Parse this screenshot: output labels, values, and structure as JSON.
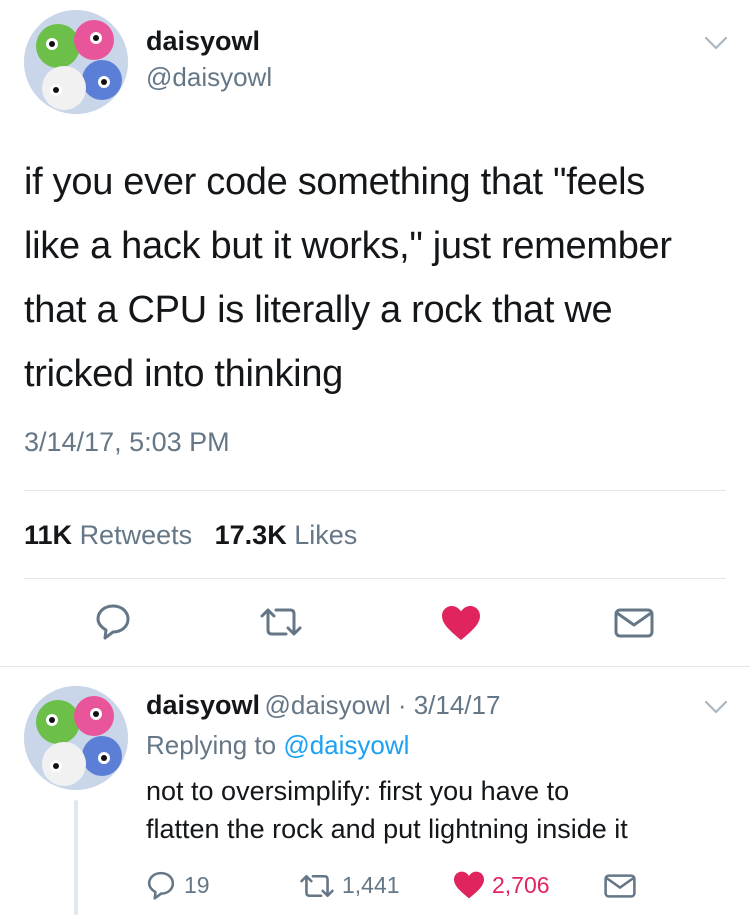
{
  "main_tweet": {
    "display_name": "daisyowl",
    "handle": "@daisyowl",
    "text_lines": [
      "if you ever code something that \"feels",
      "like a hack but it works,\" just remember",
      "that a CPU is literally a rock that we",
      "tricked into thinking"
    ],
    "timestamp": "3/14/17, 5:03 PM",
    "retweet_count": "11K",
    "retweet_label": "Retweets",
    "like_count": "17.3K",
    "like_label": "Likes"
  },
  "reply_tweet": {
    "display_name": "daisyowl",
    "handle_date": "@daisyowl · 3/14/17",
    "replying_prefix": "Replying to",
    "replying_to": "@daisyowl",
    "text_lines": [
      "not to oversimplify: first you have to",
      "flatten the rock and put lightning inside it"
    ],
    "reply_count": "19",
    "retweet_count": "1,441",
    "like_count": "2,706"
  },
  "colors": {
    "accent": "#1da1f2",
    "like": "#e0245e",
    "muted": "#657786",
    "divider": "#e1e8ed"
  },
  "icons": [
    "chevron-down-icon",
    "reply-icon",
    "retweet-icon",
    "heart-icon",
    "dm-icon"
  ]
}
